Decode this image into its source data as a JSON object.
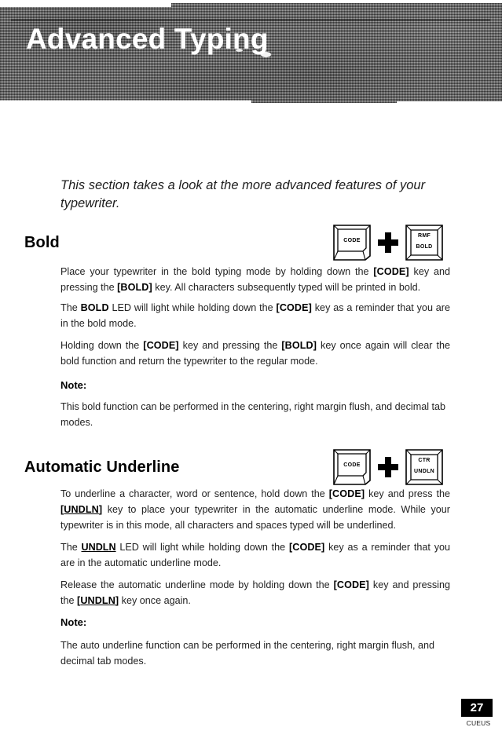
{
  "banner": {
    "title": "Advanced Typing"
  },
  "intro": "This section takes a look at the more advanced features of your typewriter.",
  "sections": [
    {
      "heading": "Bold",
      "keycombo": {
        "left_key": {
          "label": "CODE"
        },
        "operator": "+",
        "right_key": {
          "label_top": "RMF",
          "label_bottom": "BOLD"
        }
      },
      "paragraphs": [
        "Place your typewriter in the bold typing mode by holding down the [CODE] key and pressing the [BOLD] key. All characters subsequently typed will be printed in bold.",
        "The BOLD LED will light while holding down the [CODE] key as a reminder that you are in the bold mode.",
        "Holding down the [CODE] key and pressing the [BOLD] key once again will clear the bold function and return the typewriter to the regular mode."
      ],
      "note_label": "Note:",
      "note_text": "This bold function can be performed in the centering, right margin flush, and decimal tab modes."
    },
    {
      "heading": "Automatic Underline",
      "keycombo": {
        "left_key": {
          "label": "CODE"
        },
        "operator": "+",
        "right_key": {
          "label_top": "CTR",
          "label_bottom": "UNDLN"
        }
      },
      "paragraphs": [
        "To underline a character, word or sentence, hold down the [CODE] key and press the [UNDLN] key to place your typewriter in the automatic underline mode. While your typewriter is in this mode, all characters and spaces typed will be underlined.",
        "The UNDLN LED will light while holding down the [CODE] key as a reminder that you are in the automatic underline mode.",
        "Release the automatic underline mode by holding down the [CODE] key and pressing the [UNDLN] key once again."
      ],
      "note_label": "Note:",
      "note_text": "The auto underline function can be performed in the centering, right margin flush, and decimal tab modes."
    }
  ],
  "footer": {
    "page_number": "27",
    "imprint": "CUEUS"
  }
}
